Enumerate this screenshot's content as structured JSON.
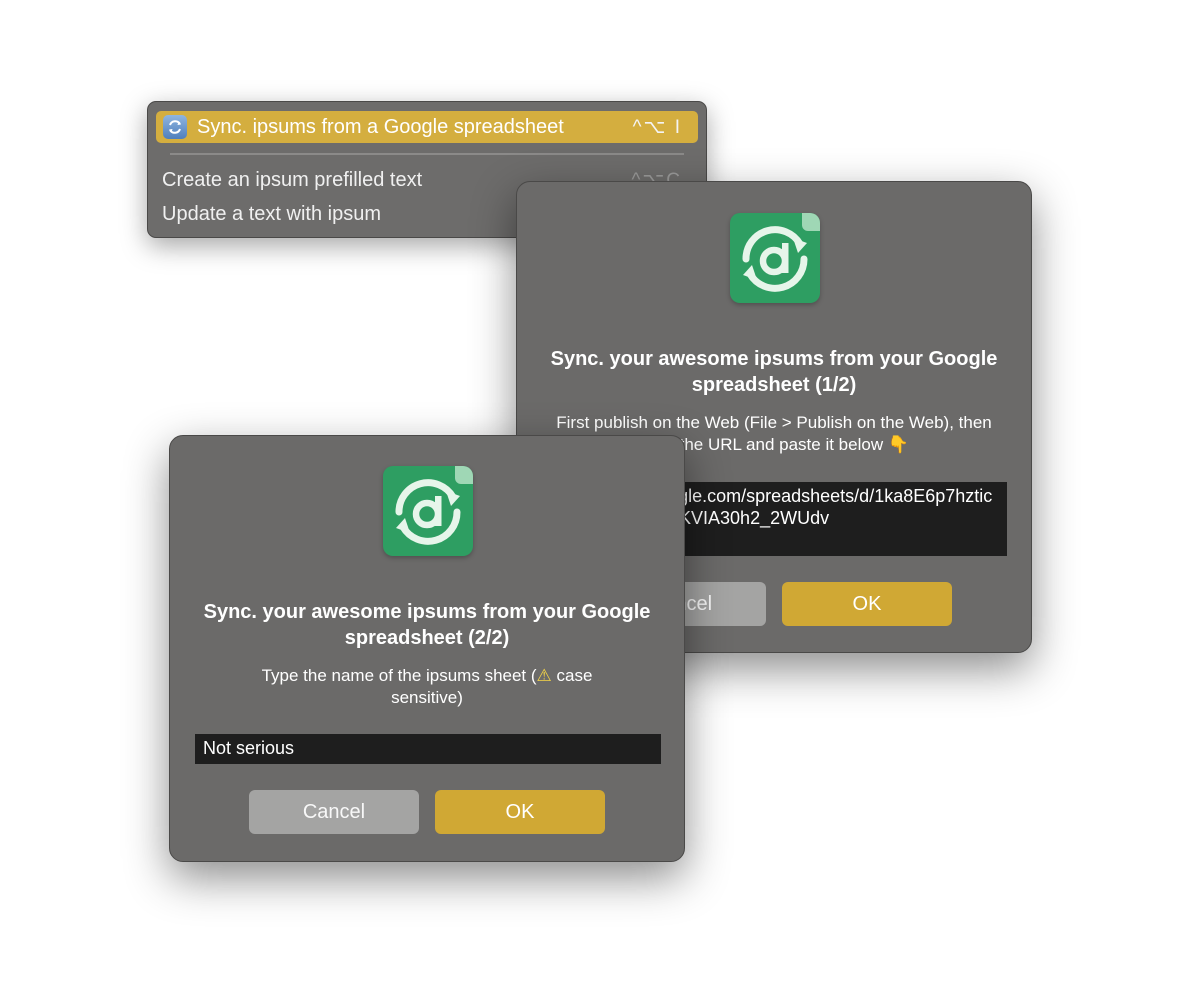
{
  "menu": {
    "items": [
      {
        "label": "Sync. ipsums from a Google spreadsheet",
        "shortcut": "^⌥ I",
        "icon": "sync-icon",
        "selected": true
      },
      {
        "label": "Create an ipsum prefilled text",
        "shortcut": "^⌥C"
      },
      {
        "label": "Update a text with ipsum"
      }
    ]
  },
  "dialog1": {
    "icon": "app-icon",
    "title": "Sync. your awesome ipsums from your Google spreadsheet (1/2)",
    "text": "First publish on the Web (File > Publish on the Web), then copy the URL and paste it below",
    "text_emoji": "👇",
    "url_value": "https://docs.google.com/spreadsheets/d/1ka8E6p7hzticCyrRxyDGsgU8KVIA30h2_2WUdv",
    "cancel_label": "Cancel",
    "ok_label": "OK"
  },
  "dialog2": {
    "icon": "app-icon",
    "title": "Sync. your awesome ipsums from your Google spreadsheet (2/2)",
    "text_before": "Type the name of the ipsums sheet (",
    "text_warn": "⚠",
    "text_after": " case sensitive)",
    "sheet_value": "Not serious",
    "cancel_label": "Cancel",
    "ok_label": "OK"
  },
  "colors": {
    "accent": "#d0a834",
    "menu_selection": "#d4ae3f",
    "app_icon_green": "#2e9e62",
    "dialog_bg": "#6b6a69"
  }
}
